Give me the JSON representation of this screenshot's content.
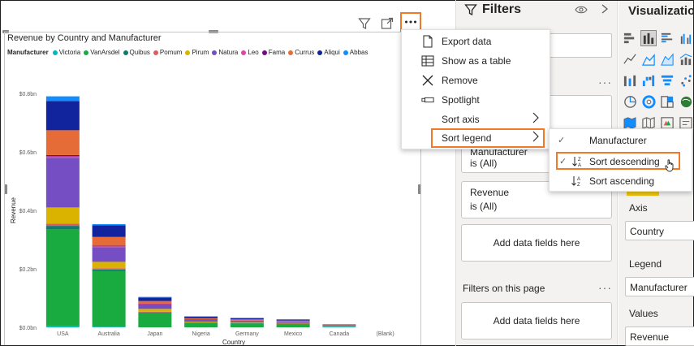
{
  "visual_header": {
    "filter_icon": "filter-icon",
    "focus_icon": "focus-mode-icon",
    "more_icon": "more-options-icon"
  },
  "chart_data": {
    "type": "bar",
    "stacked": true,
    "title": "Revenue by Country and Manufacturer",
    "xlabel": "Country",
    "ylabel": "Revenue",
    "ylim": [
      0,
      0.8
    ],
    "yticks": [
      "$0.0bn",
      "$0.2bn",
      "$0.4bn",
      "$0.6bn",
      "$0.8bn"
    ],
    "ytick_values": [
      0,
      0.2,
      0.4,
      0.6,
      0.8
    ],
    "grid": false,
    "legend_title": "Manufacturer",
    "legend_position": "top-left",
    "categories": [
      "USA",
      "Australia",
      "Japan",
      "Nigeria",
      "Germany",
      "Mexico",
      "Canada",
      "(Blank)"
    ],
    "series": [
      {
        "name": "Victoria",
        "color": "#00b7c3",
        "values": [
          0.005,
          0.002,
          0,
          0,
          0,
          0,
          0.002,
          0
        ]
      },
      {
        "name": "VanArsdel",
        "color": "#1aab40",
        "values": [
          0.33,
          0.19,
          0.048,
          0.014,
          0.013,
          0.011,
          0.003,
          0
        ]
      },
      {
        "name": "Quibus",
        "color": "#0f7b6c",
        "values": [
          0.012,
          0.006,
          0.003,
          0.001,
          0.001,
          0.001,
          0,
          0
        ]
      },
      {
        "name": "Pomum",
        "color": "#e15b5b",
        "values": [
          0.008,
          0.004,
          0.002,
          0.001,
          0.001,
          0.001,
          0,
          0
        ]
      },
      {
        "name": "Pirum",
        "color": "#d9b300",
        "values": [
          0.055,
          0.022,
          0.01,
          0.003,
          0.003,
          0.002,
          0.001,
          0
        ]
      },
      {
        "name": "Natura",
        "color": "#744ec2",
        "values": [
          0.17,
          0.05,
          0.015,
          0.006,
          0.005,
          0.004,
          0.001,
          0
        ]
      },
      {
        "name": "Leo",
        "color": "#e044a7",
        "values": [
          0.005,
          0.003,
          0.001,
          0.001,
          0.001,
          0.001,
          0,
          0
        ]
      },
      {
        "name": "Fama",
        "color": "#750985",
        "values": [
          0.004,
          0.002,
          0.001,
          0.001,
          0,
          0,
          0,
          0
        ]
      },
      {
        "name": "Currus",
        "color": "#e66c37",
        "values": [
          0.085,
          0.03,
          0.01,
          0.004,
          0.003,
          0.003,
          0.001,
          0
        ]
      },
      {
        "name": "Aliqui",
        "color": "#12239e",
        "values": [
          0.1,
          0.04,
          0.012,
          0.005,
          0.004,
          0.003,
          0.001,
          0
        ]
      },
      {
        "name": "Abbas",
        "color": "#118dff",
        "values": [
          0.016,
          0.004,
          0.002,
          0.001,
          0.001,
          0.001,
          0,
          0
        ]
      }
    ]
  },
  "context_menu": {
    "items": [
      {
        "label": "Export data",
        "icon": "export-data-icon"
      },
      {
        "label": "Show as a table",
        "icon": "show-table-icon"
      },
      {
        "label": "Remove",
        "icon": "remove-icon"
      },
      {
        "label": "Spotlight",
        "icon": "spotlight-icon"
      },
      {
        "label": "Sort axis",
        "icon": ""
      },
      {
        "label": "Sort legend",
        "icon": ""
      }
    ]
  },
  "sort_submenu": {
    "items": [
      {
        "label": "Manufacturer",
        "checked": true
      },
      {
        "label": "Sort descending",
        "icon": "sort-descending-icon"
      },
      {
        "label": "Sort ascending",
        "icon": "sort-ascending-icon"
      }
    ]
  },
  "filters_pane": {
    "title": "Filters",
    "cards": [
      {
        "field": "Manufacturer",
        "value": "is (All)"
      },
      {
        "field": "Revenue",
        "value": "is (All)"
      }
    ],
    "add_fields_label": "Add data fields here",
    "page_section_label": "Filters on this page",
    "page_add_fields_label": "Add data fields here"
  },
  "viz_pane": {
    "title": "Visualizations",
    "axis_label": "Axis",
    "axis_value": "Country",
    "legend_label": "Legend",
    "legend_value": "Manufacturer",
    "values_label": "Values",
    "values_value": "Revenue"
  },
  "colors": {
    "accent": "#f07a28",
    "pane_bg": "#f3f2f1"
  }
}
